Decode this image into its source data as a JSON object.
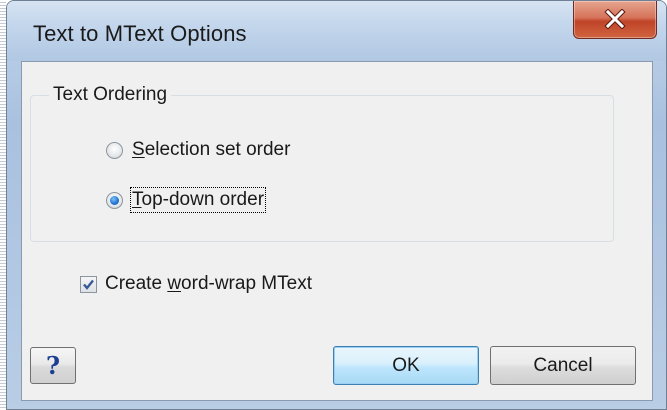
{
  "window": {
    "title": "Text to MText Options"
  },
  "titlebar_buttons": {
    "close_icon": "close-icon"
  },
  "group": {
    "legend": "Text Ordering",
    "options": [
      {
        "mnemonic": "S",
        "rest": "election set order",
        "selected": false
      },
      {
        "mnemonic": "T",
        "rest": "op-down order",
        "selected": true
      }
    ]
  },
  "checkbox": {
    "prefix": "Create ",
    "mnemonic": "w",
    "rest": "ord-wrap MText",
    "checked": true
  },
  "buttons": {
    "help": "?",
    "ok": "OK",
    "cancel": "Cancel"
  },
  "colors": {
    "close_button": "#c8502f",
    "ok_button_border": "#3c7fb1",
    "radio_selected": "#1f6fd0",
    "help_glyph": "#1c3f94"
  }
}
